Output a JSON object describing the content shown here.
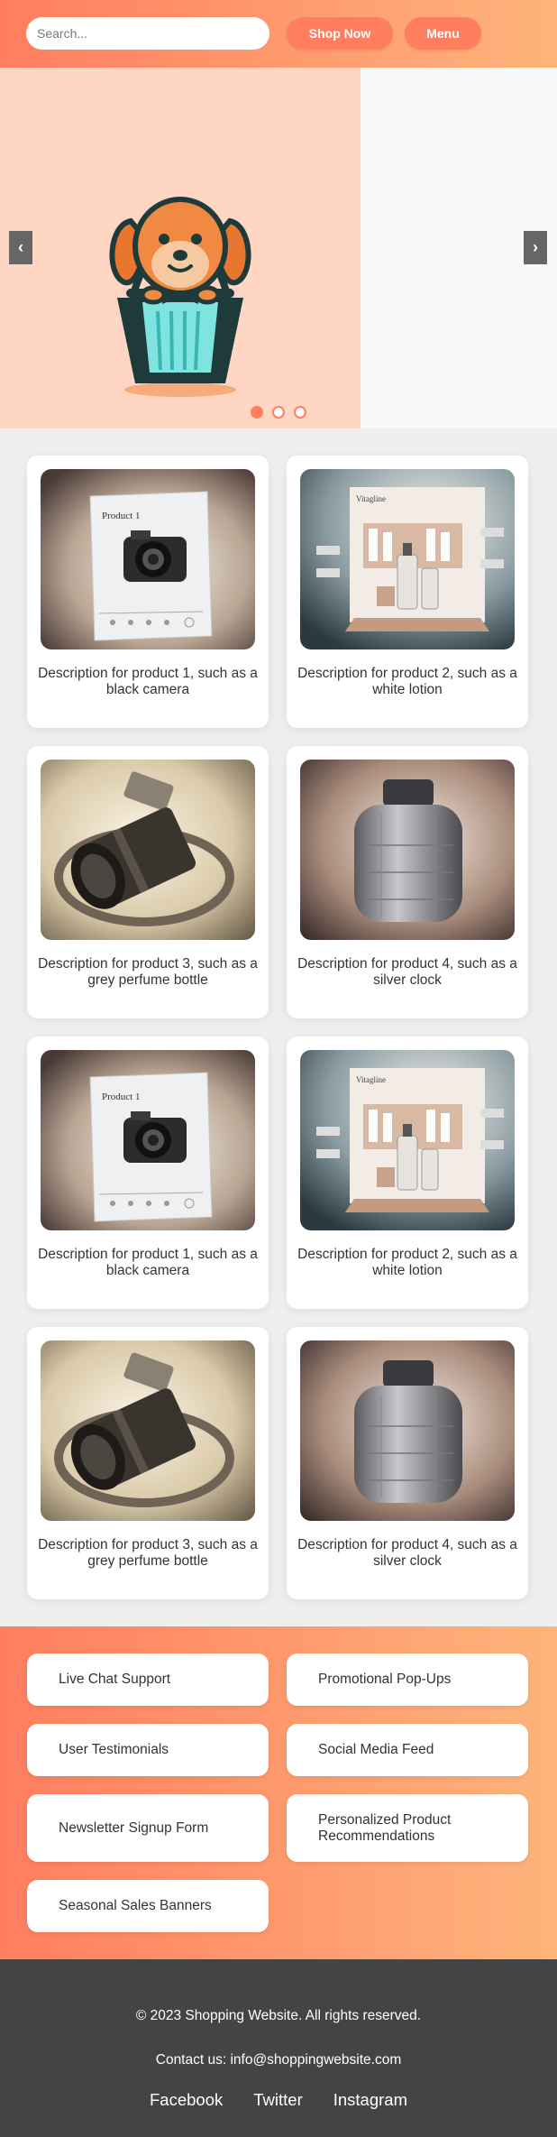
{
  "header": {
    "search_placeholder": "Search...",
    "shop_now_label": "Shop Now",
    "menu_label": "Menu"
  },
  "carousel": {
    "prev_glyph": "‹",
    "next_glyph": "›",
    "active_index": 0,
    "slide_count": 3,
    "slide_icon": "dog-mascot-shopping-basket-icon"
  },
  "products": [
    {
      "image_label": "Product 1",
      "description": "Description for product 1, such as a black camera",
      "icon": "camera-box-image"
    },
    {
      "image_label": "Vitagline",
      "description": "Description for product 2, such as a white lotion",
      "icon": "lotion-display-image"
    },
    {
      "description": "Description for product 3, such as a grey perfume bottle",
      "icon": "camera-lens-image"
    },
    {
      "description": "Description for product 4, such as a silver clock",
      "icon": "silver-jar-image"
    },
    {
      "image_label": "Product 1",
      "description": "Description for product 1, such as a black camera",
      "icon": "camera-box-image"
    },
    {
      "image_label": "Vitagline",
      "description": "Description for product 2, such as a white lotion",
      "icon": "lotion-display-image"
    },
    {
      "description": "Description for product 3, such as a grey perfume bottle",
      "icon": "camera-lens-image"
    },
    {
      "description": "Description for product 4, such as a silver clock",
      "icon": "silver-jar-image"
    }
  ],
  "features": [
    "Live Chat Support",
    "Promotional Pop-Ups",
    "User Testimonials",
    "Social Media Feed",
    "Newsletter Signup Form",
    "Personalized Product Recommendations",
    "Seasonal Sales Banners"
  ],
  "footer": {
    "copyright": "© 2023 Shopping Website. All rights reserved.",
    "contact": "Contact us: info@shoppingwebsite.com",
    "social": [
      "Facebook",
      "Twitter",
      "Instagram"
    ]
  },
  "colors": {
    "accent": "#ff7e5f",
    "accent_light": "#feb47b",
    "footer_bg": "#444444"
  }
}
